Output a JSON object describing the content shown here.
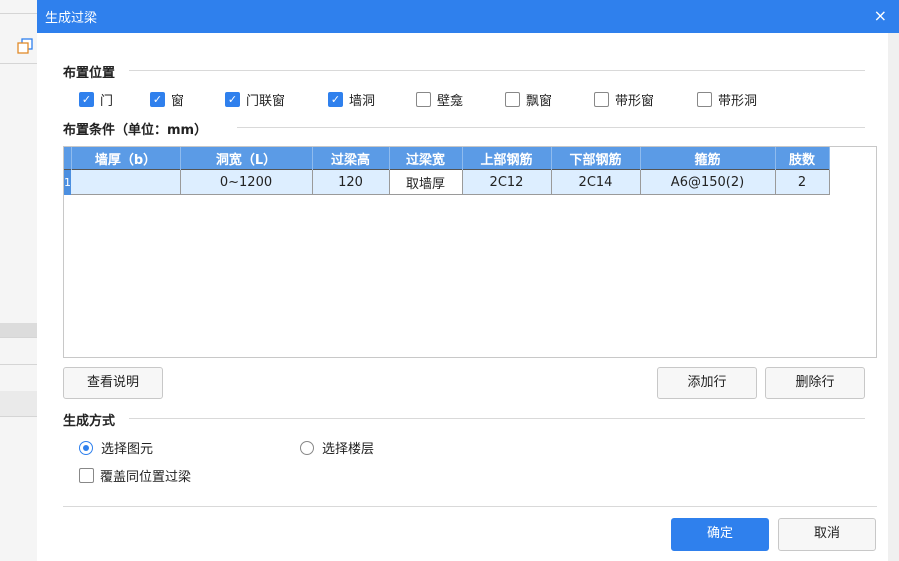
{
  "dialog": {
    "title": "生成过梁",
    "close_label": "×"
  },
  "placement": {
    "section_title": "布置位置",
    "options": [
      {
        "label": "门",
        "checked": true
      },
      {
        "label": "窗",
        "checked": true
      },
      {
        "label": "门联窗",
        "checked": true
      },
      {
        "label": "墙洞",
        "checked": true
      },
      {
        "label": "壁龛",
        "checked": false
      },
      {
        "label": "飘窗",
        "checked": false
      },
      {
        "label": "带形窗",
        "checked": false
      },
      {
        "label": "带形洞",
        "checked": false
      }
    ]
  },
  "conditions": {
    "section_title": "布置条件（单位：mm）",
    "headers": [
      "墙厚（b）",
      "洞宽（L）",
      "过梁高",
      "过梁宽",
      "上部钢筋",
      "下部钢筋",
      "箍筋",
      "肢数"
    ],
    "rows": [
      {
        "num": "1",
        "cells": [
          "",
          "0~1200",
          "120",
          "取墙厚",
          "2C12",
          "2C14",
          "A6@150(2)",
          "2"
        ]
      }
    ]
  },
  "buttons": {
    "help": "查看说明",
    "add_row": "添加行",
    "delete_row": "删除行",
    "ok": "确定",
    "cancel": "取消"
  },
  "generate": {
    "section_title": "生成方式",
    "radio_select_element": "选择图元",
    "radio_select_floor": "选择楼层",
    "selected": "选择图元",
    "overwrite_label": "覆盖同位置过梁",
    "overwrite_checked": false
  },
  "colors": {
    "accent": "#2f80ed",
    "header_blue": "#5b9be6"
  }
}
